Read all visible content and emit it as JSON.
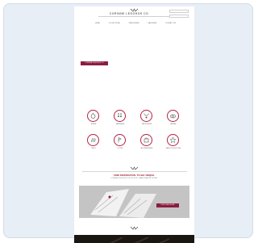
{
  "header": {
    "brand": "CORINNE LEGOHOS CO",
    "search_placeholder": "",
    "select_value": ""
  },
  "nav": {
    "items": [
      "HOME",
      "COLLECTIONS",
      "CATEGORIES",
      "GALLERIES",
      "CONTACT US"
    ]
  },
  "hero": {
    "cta_label": "CORINNE LEGOHOS CO"
  },
  "categories": {
    "items": [
      {
        "label": "RINGS",
        "icon": "ring-icon"
      },
      {
        "label": "EARRINGS",
        "icon": "earrings-icon"
      },
      {
        "label": "NECKLACES",
        "icon": "necklace-icon"
      },
      {
        "label": "BRIDAL",
        "icon": "bridal-icon"
      },
      {
        "label": "SETS",
        "icon": "sets-icon"
      },
      {
        "label": "LOOKS",
        "icon": "looks-icon"
      },
      {
        "label": "ACCESSORIES",
        "icon": "accessories-icon"
      },
      {
        "label": "NEW COLLECTION",
        "icon": "new-collection-icon"
      }
    ]
  },
  "promo": {
    "heading": "FIND INSPIRATION. TO BE UNIQUE.",
    "subtext": "CORINNE LEGOHOS COLLECTION · HANDCRAFTED IN ITALY",
    "button_label": "DISCOVER MORE"
  },
  "colors": {
    "accent": "#8c1d3f",
    "icon_ring": "#b4233f",
    "footer": "#1a1612"
  }
}
